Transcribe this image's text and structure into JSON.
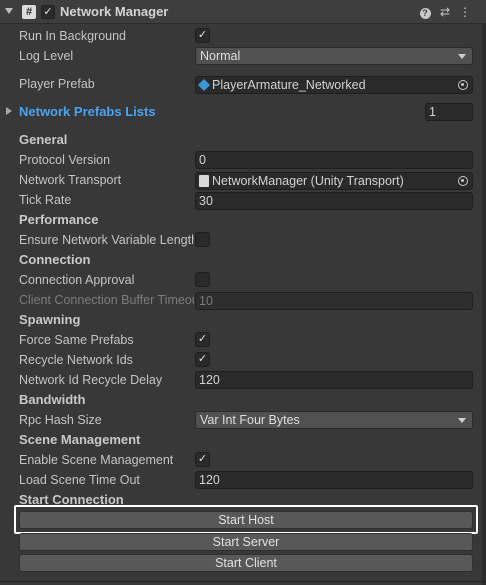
{
  "header": {
    "title": "Network Manager",
    "enabled_check": "✓",
    "script_icon_glyph": "#",
    "icons": [
      "help-icon",
      "presets-icon",
      "more-icon"
    ]
  },
  "fields": {
    "run_in_background": {
      "label": "Run In Background",
      "checked": "✓"
    },
    "log_level": {
      "label": "Log Level",
      "value": "Normal"
    },
    "player_prefab": {
      "label": "Player Prefab",
      "value": "PlayerArmature_Networked"
    },
    "network_prefabs_lists": {
      "label": "Network Prefabs Lists",
      "count": "1"
    }
  },
  "general": {
    "heading": "General",
    "protocol_version": {
      "label": "Protocol Version",
      "value": "0"
    },
    "network_transport": {
      "label": "Network Transport",
      "value": "NetworkManager (Unity Transport)"
    },
    "tick_rate": {
      "label": "Tick Rate",
      "value": "30"
    }
  },
  "performance": {
    "heading": "Performance",
    "ensure_nv_length": {
      "label": "Ensure Network Variable Length Safety",
      "checked": ""
    }
  },
  "connection": {
    "heading": "Connection",
    "connection_approval": {
      "label": "Connection Approval",
      "checked": ""
    },
    "client_buffer_timeout": {
      "label": "Client Connection Buffer Timeout",
      "value": "10"
    }
  },
  "spawning": {
    "heading": "Spawning",
    "force_same_prefabs": {
      "label": "Force Same Prefabs",
      "checked": "✓"
    },
    "recycle_network_ids": {
      "label": "Recycle Network Ids",
      "checked": "✓"
    },
    "network_id_recycle_delay": {
      "label": "Network Id Recycle Delay",
      "value": "120"
    }
  },
  "bandwidth": {
    "heading": "Bandwidth",
    "rpc_hash_size": {
      "label": "Rpc Hash Size",
      "value": "Var Int Four Bytes"
    }
  },
  "scene_management": {
    "heading": "Scene Management",
    "enable_scene_management": {
      "label": "Enable Scene Management",
      "checked": "✓"
    },
    "load_scene_timeout": {
      "label": "Load Scene Time Out",
      "value": "120"
    }
  },
  "start_connection": {
    "heading": "Start Connection",
    "start_host": "Start Host",
    "start_server": "Start Server",
    "start_client": "Start Client"
  },
  "colors": {
    "background": "#383838",
    "field": "#2a2a2a",
    "foldout_link": "#4aa3f0",
    "highlight_border": "#ffffff"
  }
}
